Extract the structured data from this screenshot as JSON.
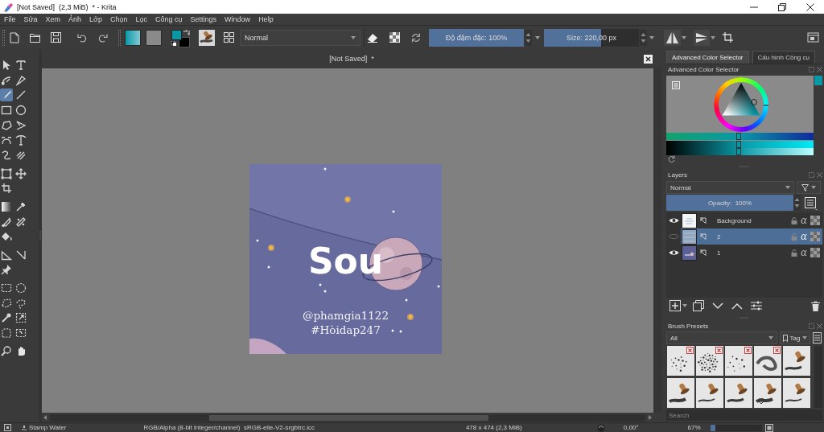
{
  "window": {
    "title": "[Not Saved]  (2,3 MiB)  * - Krita"
  },
  "menu": [
    "File",
    "Sửa",
    "Xem",
    "Ảnh",
    "Lớp",
    "Chọn",
    "Lọc",
    "Công cụ",
    "Settings",
    "Window",
    "Help"
  ],
  "toolbar": {
    "colors": [
      {
        "color": "#0a98a6"
      },
      {
        "color": "#000000"
      }
    ],
    "blend_mode": "Normal",
    "opacity": {
      "label": "Độ đậm đặc: 100%",
      "level": 1
    },
    "size": {
      "label": "Size: 220,00 px",
      "level": 0.6
    }
  },
  "toolbox": {
    "groups": [
      {
        "tools": [
          {
            "selected": false
          },
          {
            "selected": false
          },
          {
            "selected": false
          },
          {
            "selected": false
          },
          {
            "selected": true
          },
          {
            "selected": false
          },
          {
            "selected": false
          },
          {
            "selected": false
          },
          {
            "selected": false
          },
          {
            "selected": false
          },
          {
            "selected": false
          },
          {
            "selected": false
          },
          {
            "selected": false
          },
          {
            "selected": false
          }
        ]
      },
      {
        "tools": [
          {
            "selected": false
          },
          {
            "selected": false
          },
          {
            "selected": false
          }
        ]
      },
      {
        "tools": [
          {
            "selected": false
          },
          {
            "selected": false
          },
          {
            "selected": false
          },
          {
            "selected": false
          },
          {
            "selected": false
          }
        ]
      },
      {
        "tools": [
          {
            "selected": false
          },
          {
            "selected": false
          },
          {
            "selected": false
          }
        ]
      },
      {
        "tools": [
          {
            "selected": false
          },
          {
            "selected": false
          },
          {
            "selected": false
          },
          {
            "selected": false
          },
          {
            "selected": false
          },
          {
            "selected": false
          },
          {
            "selected": false
          },
          {
            "selected": false
          }
        ]
      },
      {
        "tools": [
          {
            "selected": false
          },
          {
            "selected": false
          }
        ]
      }
    ]
  },
  "canvas": {
    "document_tab": "[Not Saved]  *",
    "artwork": {
      "title": "Sou",
      "lines": [
        "@phamgia1122",
        "#Hòidap247"
      ]
    }
  },
  "docker": {
    "tabs": [
      {
        "label": "Advanced Color Selector",
        "selected": true
      },
      {
        "label": "Cấu hình Công cụ",
        "selected": false
      }
    ],
    "color_selector": {
      "title": "Advanced Color Selector",
      "sliders": [
        {
          "level": 0.49
        },
        {
          "level": 0.49
        },
        {
          "level": 0.49
        }
      ]
    },
    "layers": {
      "title": "Layers",
      "blend_mode": "Normal",
      "opacity": {
        "label": "Opacity:  100%",
        "level": 1
      },
      "items": [
        {
          "name": "Background",
          "visible": true,
          "selected": false,
          "alpha_lock": "α"
        },
        {
          "name": "2",
          "visible": false,
          "selected": true,
          "alpha_lock": "α"
        },
        {
          "name": "1",
          "visible": true,
          "selected": false,
          "alpha_lock": "α"
        }
      ]
    },
    "brush_presets": {
      "title": "Brush Presets",
      "filter": "All",
      "tag_button": "Tag",
      "search": {
        "placeholder": "Search"
      }
    }
  },
  "status_bar": {
    "brush_preset": "Stamp Water",
    "color_space": "RGB/Alpha (8-bit integer/channel)  sRGB-elle-V2-srgbtrc.icc",
    "image_size": "478 x 474 (2,3 MiB)",
    "rotation": "0,00°",
    "zoom": "67%",
    "zoom_slider": {
      "level": 0.1
    }
  }
}
